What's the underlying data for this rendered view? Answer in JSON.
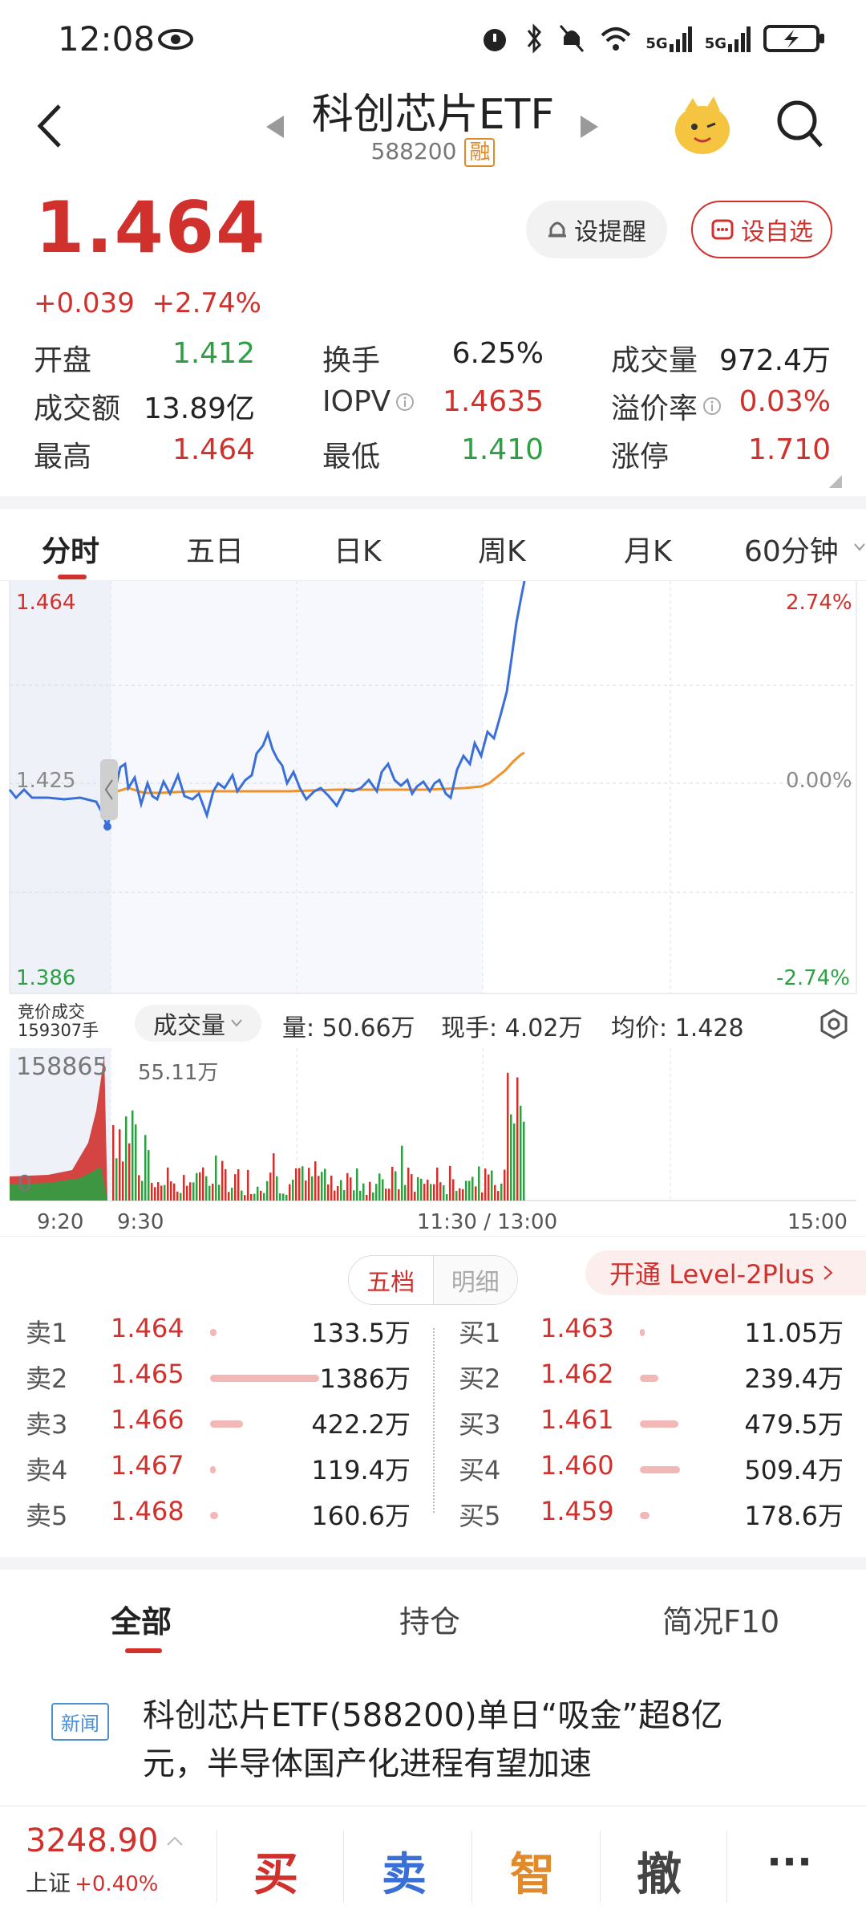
{
  "status_bar": {
    "time": "12:08",
    "net1": "5G",
    "net2": "5G"
  },
  "header": {
    "title": "科创芯片ETF",
    "code": "588200",
    "badge": "融"
  },
  "quote": {
    "price": "1.464",
    "change": "+0.039",
    "change_pct": "+2.74%"
  },
  "buttons": {
    "alert": "设提醒",
    "watch": "设自选"
  },
  "stats": {
    "open_label": "开盘",
    "open": "1.412",
    "turnover_label": "换手",
    "turnover": "6.25%",
    "volume_label": "成交量",
    "volume": "972.4万",
    "amount_label": "成交额",
    "amount": "13.89亿",
    "iopv_label": "IOPV",
    "iopv": "1.4635",
    "premium_label": "溢价率",
    "premium": "0.03%",
    "high_label": "最高",
    "high": "1.464",
    "low_label": "最低",
    "low": "1.410",
    "limit_label": "涨停",
    "limit": "1.710"
  },
  "chart_tabs": [
    "分时",
    "五日",
    "日K",
    "周K",
    "月K",
    "60分钟"
  ],
  "chart": {
    "price_high": "1.464",
    "price_mid": "1.425",
    "price_low": "1.386",
    "pct_high": "2.74%",
    "pct_mid": "0.00%",
    "pct_low": "-2.74%",
    "auction_label": "竞价成交",
    "auction_volume": "159307手",
    "vol_dropdown": "成交量",
    "vol_amount": "量: 50.66万",
    "vol_now": "现手: 4.02万",
    "vol_avg": "均价: 1.428",
    "vol_max_left": "158865",
    "vol_max_right": "55.11万",
    "vol_zero": "0",
    "time_labels": [
      "9:20",
      "9:30",
      "11:30 / 13:00",
      "15:00"
    ],
    "colors": {
      "price_line": "#3a6fd8",
      "avg_line": "#f0922b",
      "up": "#d0312d",
      "down": "#2ea043"
    }
  },
  "orderbook": {
    "tabs": [
      "五档",
      "明细"
    ],
    "level2": "开通 Level-2Plus",
    "asks": [
      {
        "label": "卖1",
        "price": "1.464",
        "vol": "133.5万",
        "bar": 0.06
      },
      {
        "label": "卖2",
        "price": "1.465",
        "vol": "1386万",
        "bar": 1.0
      },
      {
        "label": "卖3",
        "price": "1.466",
        "vol": "422.2万",
        "bar": 0.3
      },
      {
        "label": "卖4",
        "price": "1.467",
        "vol": "119.4万",
        "bar": 0.05
      },
      {
        "label": "卖5",
        "price": "1.468",
        "vol": "160.6万",
        "bar": 0.07
      }
    ],
    "bids": [
      {
        "label": "买1",
        "price": "1.463",
        "vol": "11.05万",
        "bar": 0.01
      },
      {
        "label": "买2",
        "price": "1.462",
        "vol": "239.4万",
        "bar": 0.17
      },
      {
        "label": "买3",
        "price": "1.461",
        "vol": "479.5万",
        "bar": 0.35
      },
      {
        "label": "买4",
        "price": "1.460",
        "vol": "509.4万",
        "bar": 0.37
      },
      {
        "label": "买5",
        "price": "1.459",
        "vol": "178.6万",
        "bar": 0.09
      }
    ]
  },
  "bottom_tabs": [
    "全部",
    "持仓",
    "简况F10"
  ],
  "news": {
    "badge": "新闻",
    "line1": "科创芯片ETF(588200)单日“吸金”超8亿",
    "line2": "元，半导体国产化进程有望加速"
  },
  "index": {
    "value": "3248.90",
    "name": "上证",
    "pct": "+0.40%"
  },
  "actions": {
    "buy": "买",
    "sell": "卖",
    "smart": "智",
    "cancel": "撤",
    "more": "···"
  }
}
